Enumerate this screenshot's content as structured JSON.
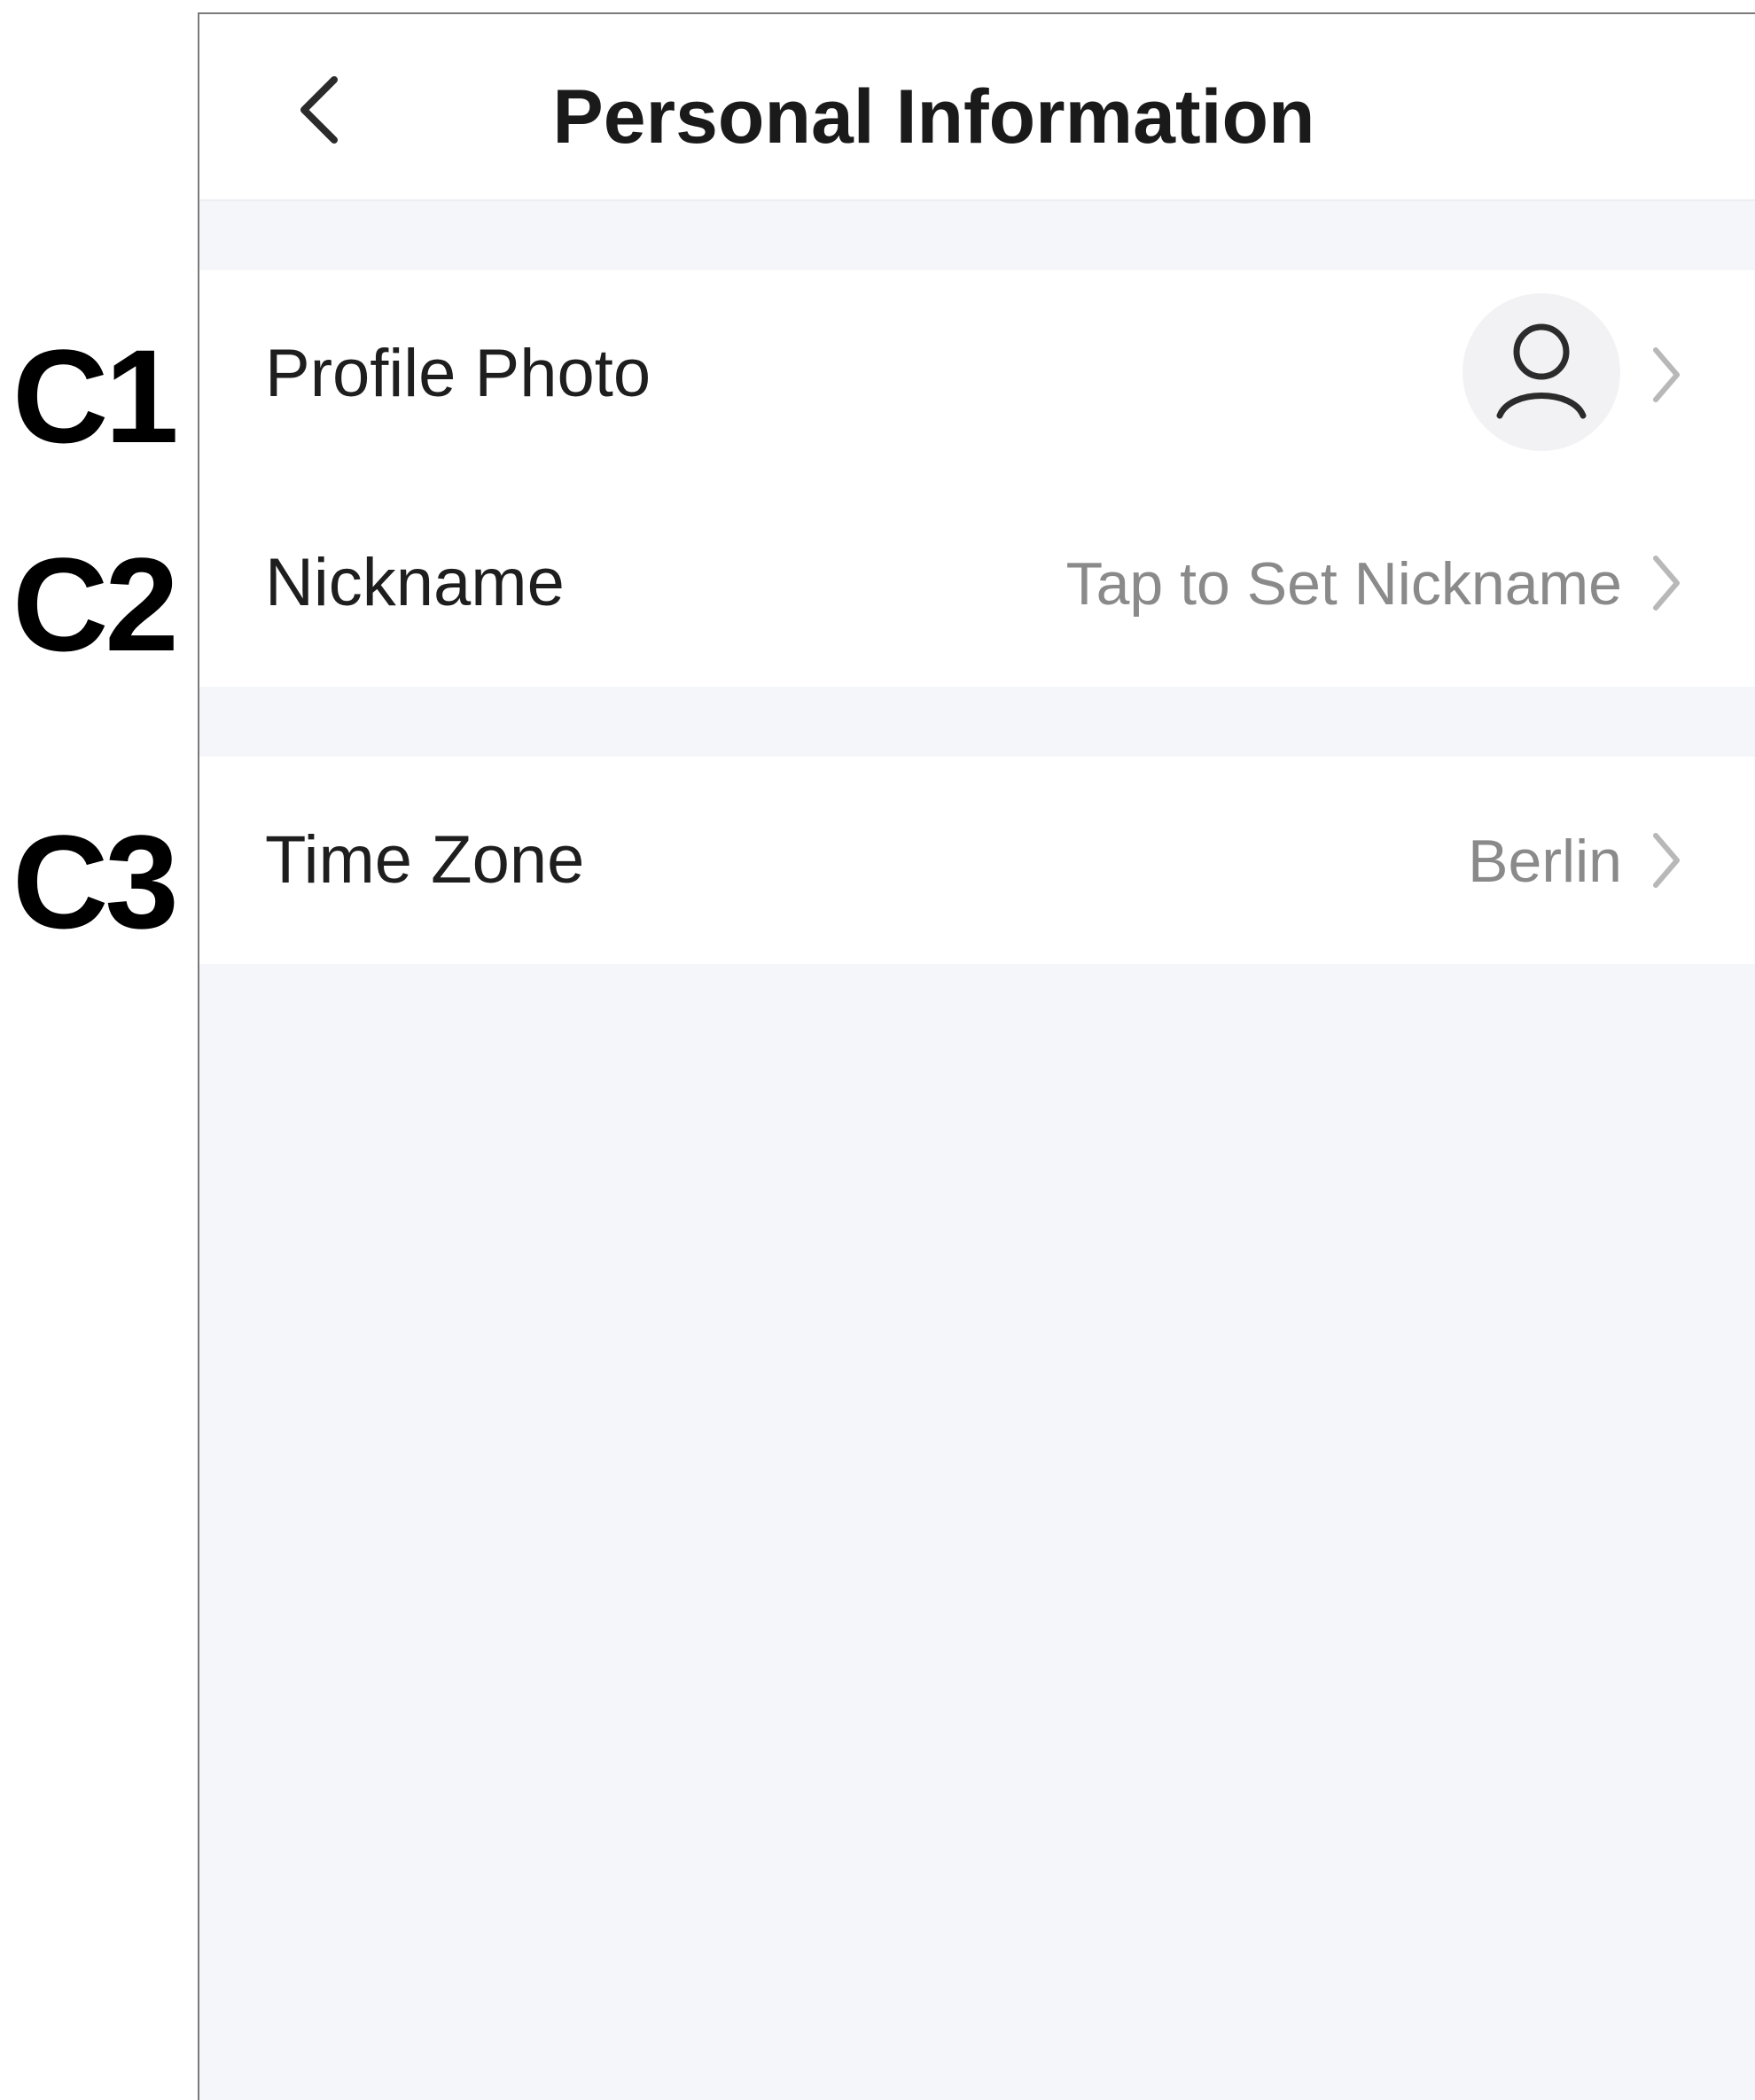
{
  "callouts": {
    "c1": "C1",
    "c2": "C2",
    "c3": "C3"
  },
  "header": {
    "title": "Personal Information",
    "back_icon": "chevron-left-icon"
  },
  "rows": {
    "profile_photo": {
      "label": "Profile Photo",
      "icon": "user-avatar-icon"
    },
    "nickname": {
      "label": "Nickname",
      "value": "Tap to Set Nickname"
    },
    "time_zone": {
      "label": "Time Zone",
      "value": "Berlin"
    }
  },
  "colors": {
    "background": "#f5f6fa",
    "card": "#ffffff",
    "label_text": "#1e1e1e",
    "value_text": "#8a8a8a",
    "chevron": "#b8b8b8"
  }
}
